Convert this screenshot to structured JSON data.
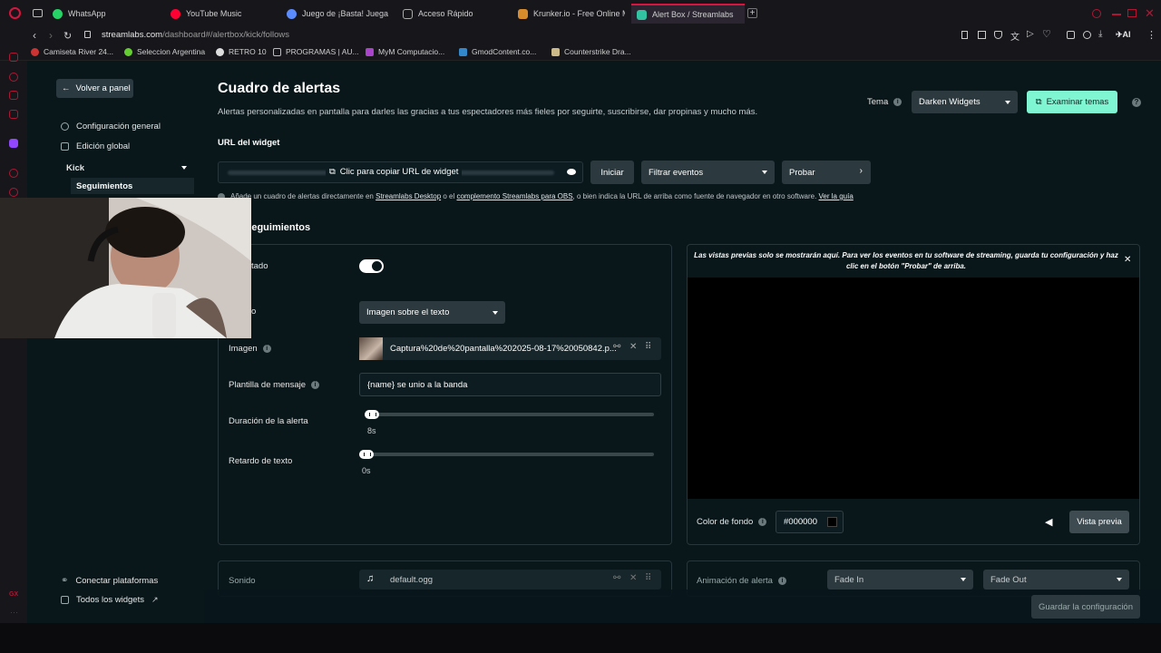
{
  "browser": {
    "tabs": [
      {
        "label": "WhatsApp",
        "color": "#25d366"
      },
      {
        "label": "YouTube Music",
        "color": "#ff0033"
      },
      {
        "label": "Juego de ¡Basta! Juega S",
        "color": "#5a8cff"
      },
      {
        "label": "Acceso Rápido",
        "color": "#888888"
      },
      {
        "label": "Krunker.io - Free Online M",
        "color": "#d98c2c"
      },
      {
        "label": "Alert Box / Streamlabs",
        "color": "#31c3a2"
      }
    ],
    "url": "streamlabs.com/dashboard#/alertbox/kick/follows",
    "url_domain": "streamlabs.com",
    "url_path": "/dashboard#/alertbox/kick/follows",
    "ai_label": "AI",
    "bookmarks": [
      "Camiseta River 24...",
      "Seleccion Argentina",
      "RETRO 10",
      "PROGRAMAS | AU...",
      "MyM Computacio...",
      "GmodContent.co...",
      "Counterstrike Dra..."
    ],
    "rail_bottom": "GX"
  },
  "sidebar": {
    "back_label": "Volver a panel",
    "general_settings": "Configuración general",
    "global_edit": "Edición global",
    "platform": "Kick",
    "follows": "Seguimientos",
    "connect": "Conectar plataformas",
    "all_widgets": "Todos los widgets"
  },
  "header": {
    "title": "Cuadro de alertas",
    "description": "Alertas personalizadas en pantalla para darles las gracias a tus espectadores más fieles por seguirte, suscribirse, dar propinas y mucho más.",
    "theme_label": "Tema",
    "theme_value": "Darken Widgets",
    "explore_label": "Examinar temas"
  },
  "widget_url": {
    "label": "URL del widget",
    "copy_label": "Clic para copiar URL de widget",
    "start_label": "Iniciar",
    "filter_label": "Filtrar eventos",
    "test_label": "Probar",
    "note_prefix": "Añade un cuadro de alertas directamente en ",
    "note_link1": "Streamlabs Desktop",
    "note_mid1": " o el ",
    "note_link2": "complemento Streamlabs para OBS",
    "note_mid2": ", o bien indica la URL de arriba como fuente de navegador en otro software. ",
    "note_link3": "Ver la guía"
  },
  "section": {
    "title": "Seguimientos",
    "enabled_label": "tado",
    "layout_label": "o",
    "layout_value": "Imagen sobre el texto",
    "image_label": "Imagen",
    "image_file": "Captura%20de%20pantalla%202025-08-17%20050842.p...",
    "template_label": "Plantilla de mensaje",
    "template_value": "{name} se unio a la banda",
    "duration_label": "Duración de la alerta",
    "duration_value": "8s",
    "delay_label": "Retardo de texto",
    "delay_value": "0s",
    "sound_label": "Sonido",
    "sound_file": "default.ogg"
  },
  "preview": {
    "notice": "Las vistas previas solo se mostrarán aquí. Para ver los eventos en tu software de streaming, guarda tu configuración y haz clic en el botón \"Probar\" de arriba.",
    "bg_label": "Color de fondo",
    "bg_value": "#000000",
    "preview_button": "Vista previa",
    "anim_label": "Animación de alerta",
    "anim_in": "Fade In",
    "anim_out": "Fade Out"
  },
  "footer": {
    "save_label": "Guardar la configuración"
  }
}
